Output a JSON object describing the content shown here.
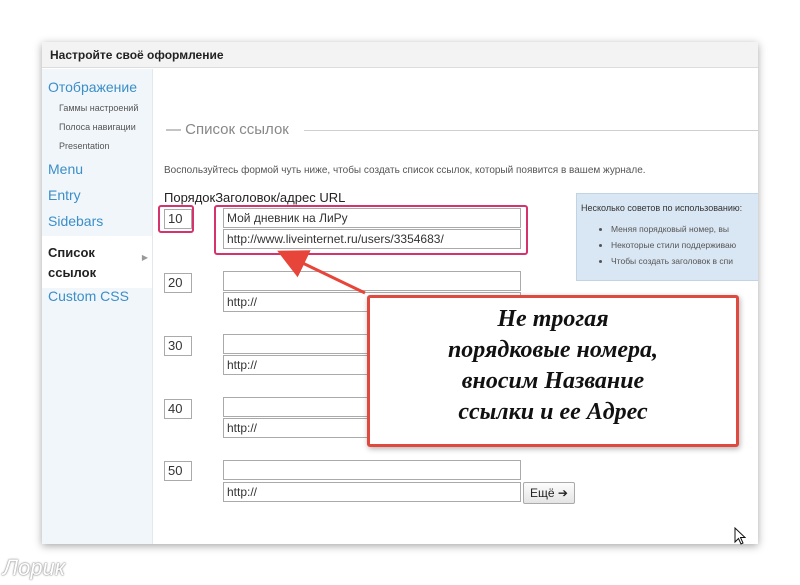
{
  "window_title": "Настройте своё оформление",
  "sidebar": {
    "items": [
      {
        "label": "Отображение"
      },
      {
        "label": "Гаммы настроений"
      },
      {
        "label": "Полоса навигации"
      },
      {
        "label": "Presentation"
      },
      {
        "label": "Menu"
      },
      {
        "label": "Entry"
      },
      {
        "label": "Sidebars"
      },
      {
        "label": "Список ссылок",
        "active": true
      },
      {
        "label": "Custom CSS"
      }
    ]
  },
  "section": {
    "title": "Список ссылок",
    "help_text": "Воспользуйтесь формой чуть ниже, чтобы создать список ссылок, который появится в вашем журнале.",
    "header_order": "Порядок",
    "header_title_url": "Заголовок/адрес URL"
  },
  "links": [
    {
      "order": "10",
      "title": "Мой дневник на ЛиРу",
      "url": "http://www.liveinternet.ru/users/3354683/"
    },
    {
      "order": "20",
      "title": "",
      "url": "http://"
    },
    {
      "order": "30",
      "title": "",
      "url": "http://"
    },
    {
      "order": "40",
      "title": "",
      "url": "http://"
    },
    {
      "order": "50",
      "title": "",
      "url": "http://"
    }
  ],
  "more_button": "Ещё ➔",
  "tips": {
    "title": "Несколько советов по использованию:",
    "items": [
      "Меняя порядковый номер, вы",
      "Некоторые стили поддерживаю",
      "Чтобы создать заголовок в спи"
    ]
  },
  "callout": {
    "lines": [
      "Не трогая",
      "порядковые номера,",
      "вносим Название",
      "ссылки и ее Адрес"
    ]
  },
  "watermark": "Лорик",
  "colors": {
    "accent_link": "#3b8ec8",
    "highlight": "#d4336d",
    "callout_border": "#e0493d",
    "arrow": "#e8453a"
  }
}
